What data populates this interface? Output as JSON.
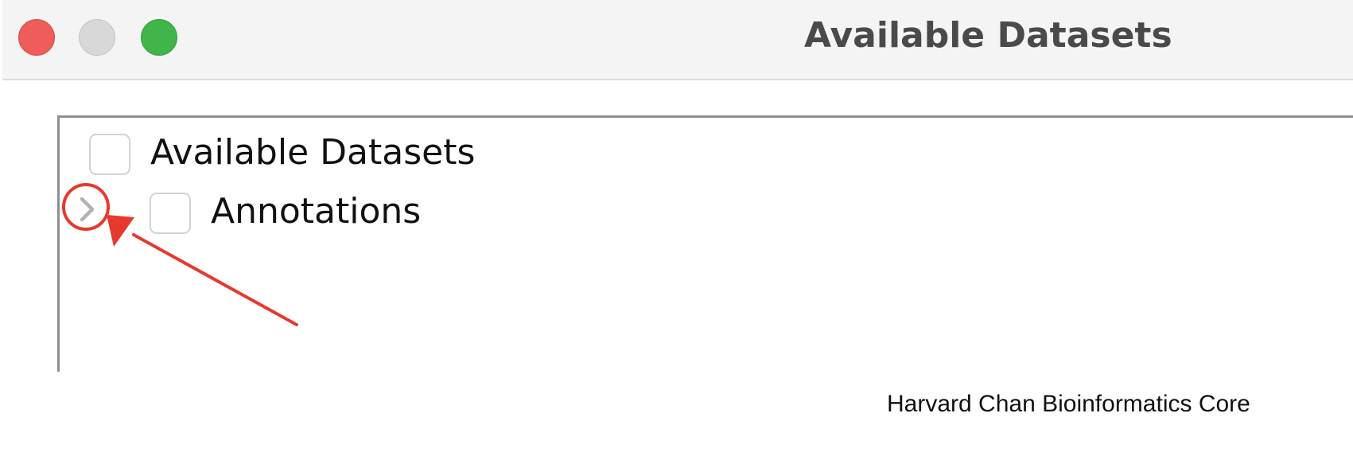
{
  "window": {
    "title": "Available Datasets",
    "buttons": {
      "close_icon": "close-icon",
      "minimize_icon": "minimize-icon",
      "zoom_icon": "zoom-icon"
    },
    "colors": {
      "close": "#ee5d59",
      "minimize": "#d8d8d8",
      "zoom": "#3fb54a"
    }
  },
  "tree": {
    "items": [
      {
        "label": "Available Datasets",
        "checked": false,
        "expandable": false
      },
      {
        "label": "Annotations",
        "checked": false,
        "expandable": true,
        "expanded": false
      }
    ],
    "disclosure_icon": "chevron-right-icon"
  },
  "annotation": {
    "color": "#e8392f",
    "shapes": [
      "highlight-circle",
      "pointer-arrow"
    ]
  },
  "footer": {
    "credit": "Harvard Chan Bioinformatics Core"
  }
}
